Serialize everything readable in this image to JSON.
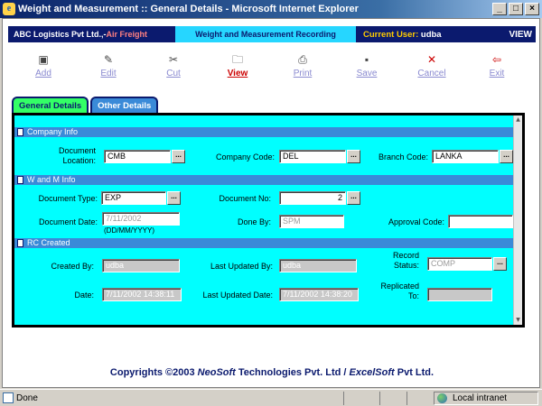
{
  "window": {
    "title": "Weight and Measurement :: General Details - Microsoft Internet Explorer",
    "controls": [
      "_",
      "□",
      "×"
    ]
  },
  "header": {
    "company": "ABC Logistics Pvt Ltd.,-",
    "company_suffix": "Air Freight",
    "section": "Weight and Measurement Recording",
    "current_user_label": "Current User:",
    "current_user": "udba",
    "view_label": "VIEW"
  },
  "toolbar": {
    "add": "Add",
    "edit": "Edit",
    "cut": "Cut",
    "view": "View",
    "print": "Print",
    "save": "Save",
    "cancel": "Cancel",
    "exit": "Exit"
  },
  "tabs": {
    "general": "General Details",
    "other": "Other Details"
  },
  "company_info": {
    "title": "Company Info",
    "document_location_label": "Document Location:",
    "document_location": "CMB",
    "company_code_label": "Company Code:",
    "company_code": "DEL",
    "branch_code_label": "Branch Code:",
    "branch_code": "LANKA"
  },
  "wm_info": {
    "title": "W and M Info",
    "document_type_label": "Document Type:",
    "document_type": "EXP",
    "document_no_label": "Document No:",
    "document_no": "2",
    "document_date_label": "Document Date:",
    "document_date": "7/11/2002",
    "date_format_hint": "(DD/MM/YYYY)",
    "done_by_label": "Done By:",
    "done_by": "SPM",
    "approval_code_label": "Approval Code:",
    "approval_code": ""
  },
  "rc_created": {
    "title": "RC Created",
    "created_by_label": "Created By:",
    "created_by": "udba",
    "last_updated_by_label": "Last Updated By:",
    "last_updated_by": "udba",
    "record_status_label": "Record Status:",
    "record_status": "COMP",
    "date_label": "Date:",
    "date": "7/11/2002 14:38:11",
    "last_updated_date_label": "Last Updated Date:",
    "last_updated_date": "7/11/2002 14:38:20",
    "replicated_to_label": "Replicated To:",
    "replicated_to": ""
  },
  "browse_label": "...",
  "footer": {
    "prefix": "Copyrights ©2003 ",
    "neosoft": "NeoSoft",
    "middle": " Technologies Pvt. Ltd / ",
    "excelsoft": "ExcelSoft",
    "suffix": " Pvt Ltd."
  },
  "status": {
    "text": "Done",
    "zone": "Local intranet"
  }
}
